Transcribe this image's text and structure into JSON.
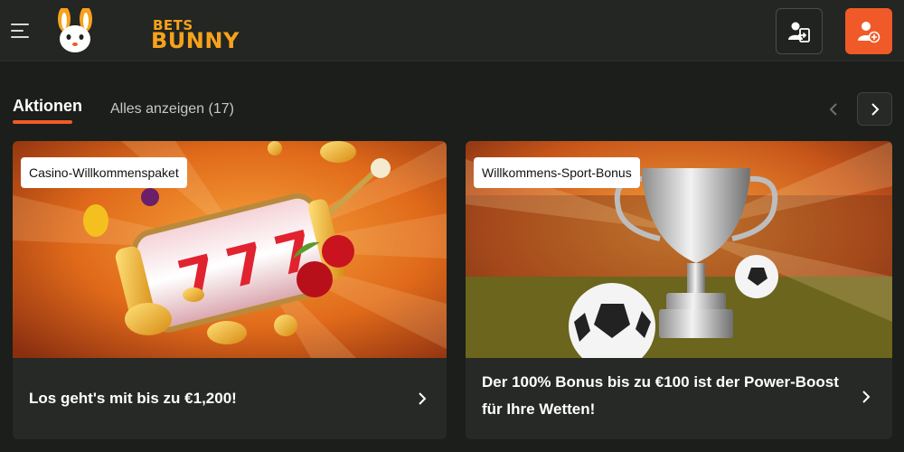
{
  "header": {
    "logo_top": "BETS",
    "logo_bottom": "BUNNY",
    "colors": {
      "background": "#232622",
      "accent": "#f05a28",
      "logo": "#f7a21b"
    },
    "icons": {
      "menu": "hamburger-icon",
      "login": "user-login-icon",
      "register": "user-add-icon"
    }
  },
  "promotions": {
    "active_tab": "Aktionen",
    "view_all": "Alles anzeigen (17)",
    "icons": {
      "prev": "chevron-left-icon",
      "next": "chevron-right-icon"
    },
    "cards": [
      {
        "badge": "Casino-Willkommenspaket",
        "title": "Los geht's mit bis zu €1,200!",
        "image": "slot-machine-777-illustration"
      },
      {
        "badge": "Willkommens-Sport-Bonus",
        "title": "Der 100% Bonus bis zu €100 ist der Power-Boost für Ihre Wetten!",
        "image": "trophy-football-illustration"
      }
    ]
  }
}
